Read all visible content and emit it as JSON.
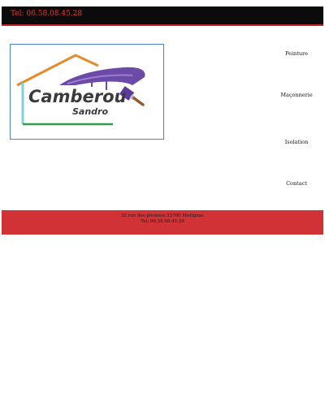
{
  "header": {
    "phone": "Tel: 06.58.08.45.28"
  },
  "logo": {
    "line1": "Camberou",
    "line2": "Sandro"
  },
  "nav": {
    "items": [
      {
        "label": "Peinture"
      },
      {
        "label": "Maçonnerie"
      },
      {
        "label": "Isolation"
      },
      {
        "label": "Contact"
      }
    ]
  },
  "footer": {
    "address": "32 rue des pivoines 33700 Merignac",
    "phone": "Tel: 06.58.08.45.28"
  },
  "colors": {
    "topbar": "#0b0b0b",
    "accent_red": "#d03236",
    "logo_border": "#4a86c5",
    "roof": "#e8892a",
    "brush": "#6b4aa8"
  }
}
